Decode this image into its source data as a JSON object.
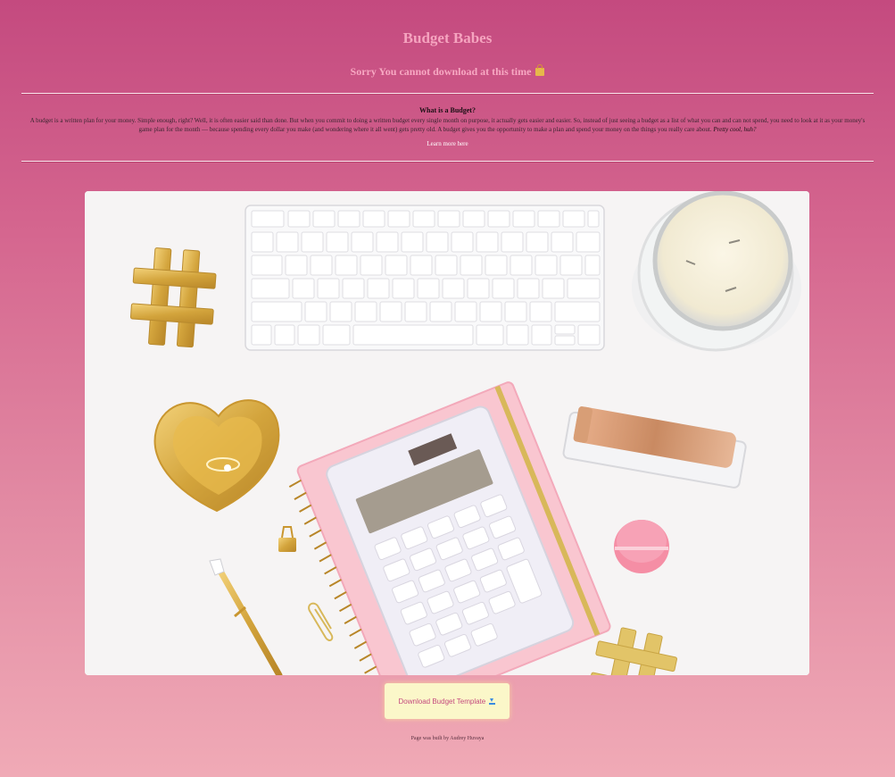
{
  "header": {
    "title": "Budget Babes",
    "notice": "Sorry You cannot download at this time",
    "notice_icon": "locked-icon"
  },
  "info": {
    "heading": "What is a Budget?",
    "body": "A budget is a written plan for your money. Simple enough, right? Well, it is often easier said than done. But when you commit to doing a written budget every single month on purpose, it actually gets easier and easier. So, instead of just seeing a budget as a list of what you can and can not spend, you need to look at it as your money's game plan for the month — because spending every dollar you make (and wondering where it all went) gets pretty old. A budget gives you the opportunity to make a plan and spend your money on the things you really care about.",
    "emphasis": "Pretty cool, huh?",
    "link_label": "Learn more here"
  },
  "hero": {
    "subject": "desk-flatlay-photo"
  },
  "download": {
    "label": "Download Budget Template",
    "icon": "download-icon"
  },
  "footer": {
    "credit": "Page was built by Audrey Huvaya"
  },
  "colors": {
    "background_top": "#c44a7f",
    "background_bottom": "#f0aab6",
    "title": "#f5a4bf",
    "button_bg": "#fbf7c9",
    "button_text": "#c44a7f"
  }
}
